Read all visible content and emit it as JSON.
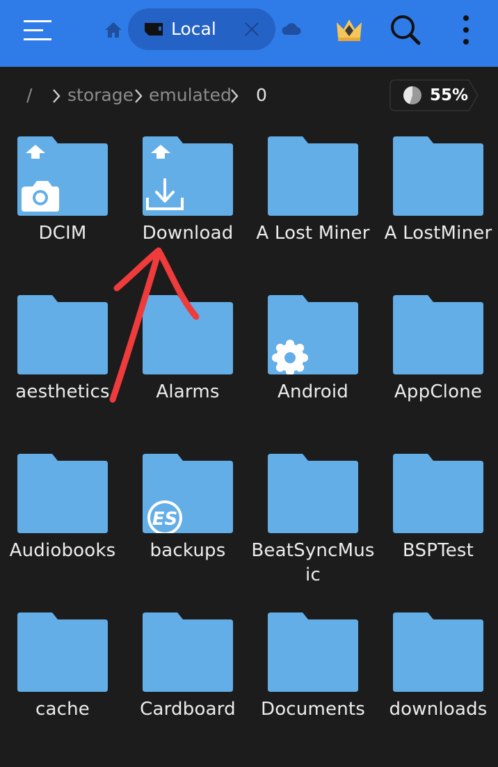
{
  "topbar": {
    "tab_label": "Local",
    "accent_color": "#2f7ce8",
    "icons": [
      "menu-icon",
      "home-icon",
      "sd-card-icon",
      "close-icon",
      "cloud-icon",
      "crown-icon",
      "search-icon",
      "more-icon"
    ]
  },
  "breadcrumb": {
    "root": "/",
    "items": [
      "storage",
      "emulated",
      "0"
    ]
  },
  "storage": {
    "usage_label": "55%",
    "used_fraction": 0.55
  },
  "folders": [
    {
      "name": "DCIM",
      "badge": "camera-icon",
      "shortcut": true
    },
    {
      "name": "Download",
      "badge": "download-icon",
      "shortcut": true
    },
    {
      "name": "A Lost Miner"
    },
    {
      "name": "A LostMiner"
    },
    {
      "name": "aesthetics"
    },
    {
      "name": "Alarms"
    },
    {
      "name": "Android",
      "badge": "gear-icon"
    },
    {
      "name": "AppClone"
    },
    {
      "name": "Audiobooks"
    },
    {
      "name": "backups",
      "badge": "es-logo-icon"
    },
    {
      "name": "BeatSyncMusic"
    },
    {
      "name": "BSPTest"
    },
    {
      "name": "cache"
    },
    {
      "name": "Cardboard"
    },
    {
      "name": "Documents"
    },
    {
      "name": "downloads"
    }
  ],
  "colors": {
    "folder": "#64aee8",
    "folder_tab": "#5aa3e0",
    "background": "#1c1c1c",
    "annotation": "#ef3b3b"
  }
}
